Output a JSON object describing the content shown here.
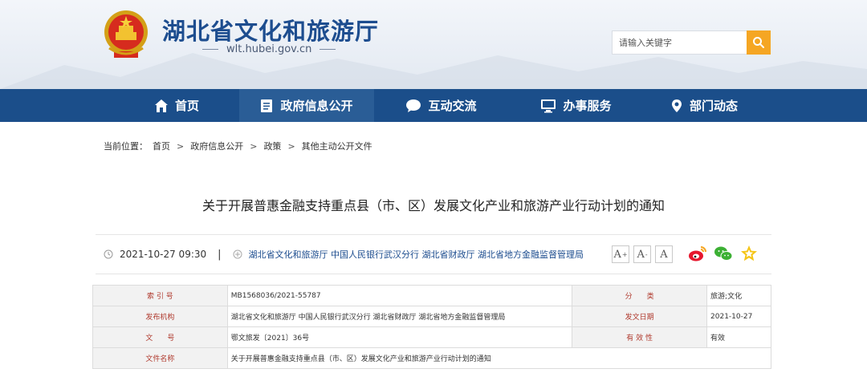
{
  "site": {
    "title": "湖北省文化和旅游厅",
    "url": "wlt.hubei.gov.cn"
  },
  "search": {
    "placeholder": "请输入关键字"
  },
  "nav": {
    "items": [
      {
        "label": "首页",
        "icon": "home-icon"
      },
      {
        "label": "政府信息公开",
        "icon": "document-icon"
      },
      {
        "label": "互动交流",
        "icon": "chat-bubble-icon"
      },
      {
        "label": "办事服务",
        "icon": "monitor-icon"
      },
      {
        "label": "部门动态",
        "icon": "location-pin-icon"
      }
    ],
    "active_index": 1
  },
  "breadcrumb": {
    "prefix": "当前位置：",
    "items": [
      "首页",
      "政府信息公开",
      "政策",
      "其他主动公开文件"
    ],
    "separator": ">"
  },
  "article": {
    "title": "关于开展普惠金融支持重点县（市、区）发展文化产业和旅游产业行动计划的通知",
    "datetime": "2021-10-27 09:30",
    "divider": "|",
    "source": "湖北省文化和旅游厅 中国人民银行武汉分行 湖北省财政厅 湖北省地方金融监督管理局"
  },
  "font_buttons": [
    {
      "label": "A",
      "sup": "+"
    },
    {
      "label": "A",
      "sup": "-"
    },
    {
      "label": "A",
      "sup": ""
    }
  ],
  "share": [
    "weibo-icon",
    "wechat-icon",
    "favorite-star-icon"
  ],
  "info_table": {
    "rows": [
      {
        "l1": "索 引 号",
        "v1": "MB1568036/2021-55787",
        "l2": "分　　类",
        "v2": "旅游;文化"
      },
      {
        "l1": "发布机构",
        "v1": "湖北省文化和旅游厅 中国人民银行武汉分行 湖北省财政厅 湖北省地方金融监督管理局",
        "l2": "发文日期",
        "v2": "2021-10-27"
      },
      {
        "l1": "文　　号",
        "v1": "鄂文旅发〔2021〕36号",
        "l2": "有 效 性",
        "v2": "有效"
      },
      {
        "l1": "文件名称",
        "v1": "关于开展普惠金融支持重点县（市、区）发展文化产业和旅游产业行动计划的通知"
      }
    ]
  },
  "colors": {
    "brand_blue": "#1b4e8a",
    "nav_active": "#2a5d96",
    "search_button": "#f5a623",
    "label_red": "#b03a2e"
  }
}
